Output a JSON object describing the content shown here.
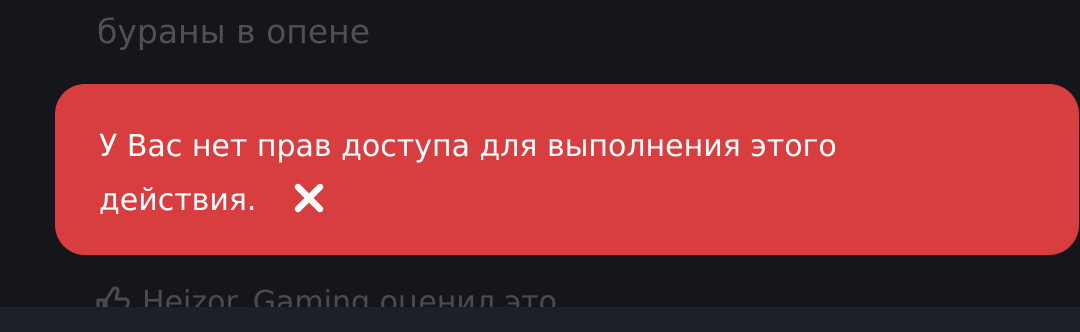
{
  "background": {
    "top_text": "бураны в опене",
    "like_text": "Heizor_Gaming оценил это"
  },
  "toast": {
    "message": "У Вас нет прав доступа для выполнения этого действия.",
    "close_icon": "close-icon",
    "color": "#d83e3f"
  }
}
